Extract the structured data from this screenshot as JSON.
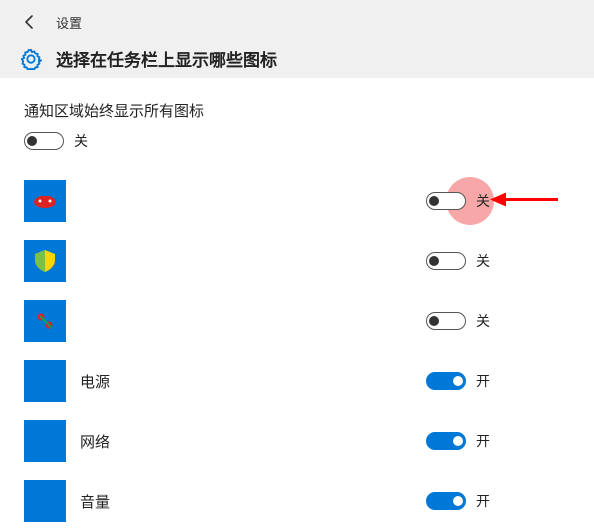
{
  "header": {
    "settings_label": "设置",
    "page_title": "选择在任务栏上显示哪些图标"
  },
  "master": {
    "label": "通知区域始终显示所有图标",
    "state_label": "关",
    "on": false
  },
  "state_labels": {
    "on": "开",
    "off": "关"
  },
  "items": [
    {
      "id": "app1",
      "label": "",
      "on": false,
      "highlighted": true
    },
    {
      "id": "app2",
      "label": "",
      "on": false,
      "highlighted": false
    },
    {
      "id": "app3",
      "label": "",
      "on": false,
      "highlighted": false
    },
    {
      "id": "power",
      "label": "电源",
      "on": true,
      "highlighted": false
    },
    {
      "id": "network",
      "label": "网络",
      "on": true,
      "highlighted": false
    },
    {
      "id": "volume",
      "label": "音量",
      "on": true,
      "highlighted": false
    }
  ],
  "colors": {
    "accent": "#0078d7",
    "highlight": "rgba(240,80,80,0.5)",
    "arrow": "#ff0000"
  }
}
